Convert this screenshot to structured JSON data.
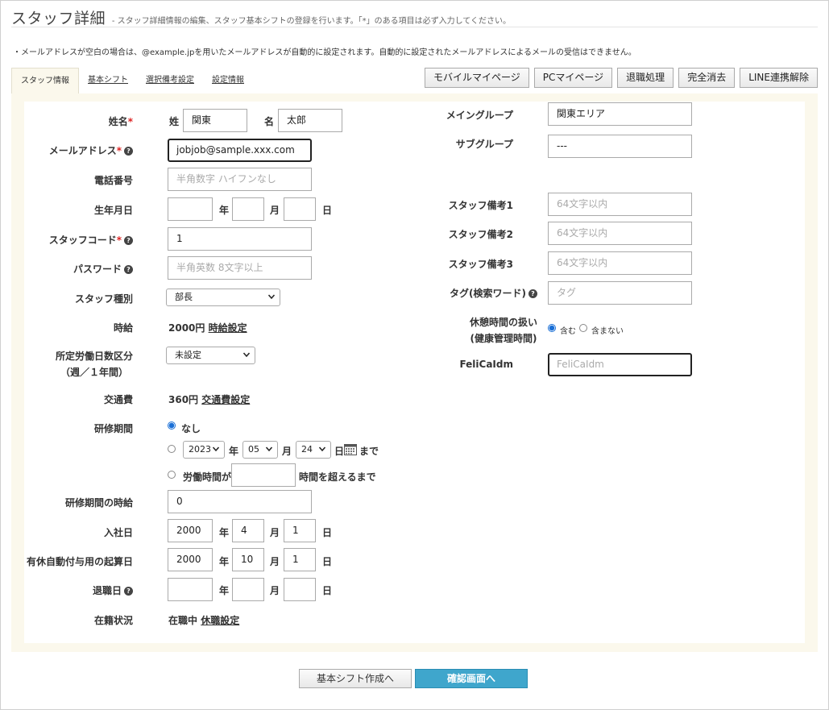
{
  "page": {
    "title": "スタッフ詳細",
    "subtitle": "- スタッフ詳細情報の編集、スタッフ基本シフトの登録を行います。「*」のある項目は必ず入力してください。",
    "notice": "・メールアドレスが空白の場合は、@example.jpを用いたメールアドレスが自動的に設定されます。自動的に設定されたメールアドレスによるメールの受信はできません。"
  },
  "tabs": [
    "スタッフ情報",
    "基本シフト",
    "選択備考設定",
    "設定情報"
  ],
  "actions": [
    "モバイルマイページ",
    "PCマイページ",
    "退職処理",
    "完全消去",
    "LINE連携解除"
  ],
  "form": {
    "name": {
      "label": "姓名",
      "req": "*",
      "sei_label": "姓",
      "sei": "関東",
      "mei_label": "名",
      "mei": "太郎"
    },
    "email": {
      "label": "メールアドレス",
      "req": "*",
      "value": "jobjob@sample.xxx.com"
    },
    "phone": {
      "label": "電話番号",
      "placeholder": "半角数字 ハイフンなし"
    },
    "birthday": {
      "label": "生年月日",
      "year_unit": "年",
      "month_unit": "月",
      "day_unit": "日"
    },
    "staff_code": {
      "label": "スタッフコード",
      "req": "*",
      "value": "1"
    },
    "password": {
      "label": "パスワード",
      "placeholder": "半角英数 8文字以上"
    },
    "staff_type": {
      "label": "スタッフ種別",
      "value": "部長"
    },
    "hourly": {
      "label": "時給",
      "value": "2000円",
      "link": "時給設定"
    },
    "workdays": {
      "label1": "所定労働日数区分",
      "label2": "（週／１年間）",
      "value": "未設定"
    },
    "transport": {
      "label": "交通費",
      "value": "360円",
      "link": "交通費設定"
    },
    "training": {
      "label": "研修期間",
      "opt_none": "なし",
      "year": "2023",
      "month": "05",
      "day": "24",
      "year_unit": "年",
      "month_unit": "月",
      "day_unit": "日",
      "until": "まで",
      "opt_hours_pre": "労働時間が",
      "opt_hours_post": "時間を超えるまで"
    },
    "training_wage": {
      "label": "研修期間の時給",
      "value": "0"
    },
    "join_date": {
      "label": "入社日",
      "year": "2000",
      "month": "4",
      "day": "1"
    },
    "paid_leave": {
      "label": "有休自動付与用の起算日",
      "year": "2000",
      "month": "10",
      "day": "1"
    },
    "retire_date": {
      "label": "退職日"
    },
    "status": {
      "label": "在籍状況",
      "value": "在職中",
      "link": "休職設定"
    },
    "main_group": {
      "label": "メイングループ",
      "value": "関東エリア"
    },
    "sub_group": {
      "label": "サブグループ",
      "value": "---"
    },
    "note1": {
      "label": "スタッフ備考1",
      "placeholder": "64文字以内"
    },
    "note2": {
      "label": "スタッフ備考2",
      "placeholder": "64文字以内"
    },
    "note3": {
      "label": "スタッフ備考3",
      "placeholder": "64文字以内"
    },
    "tag": {
      "label": "タグ(検索ワード)",
      "placeholder": "タグ"
    },
    "break": {
      "label1": "休憩時間の扱い",
      "label2": "(健康管理時間)",
      "opt_include": "含む",
      "opt_exclude": "含まない"
    },
    "felica": {
      "label": "FeliCaIdm",
      "placeholder": "FeliCaIdm"
    }
  },
  "bottom": {
    "shift_button": "基本シフト作成へ",
    "confirm_button": "確認画面へ"
  }
}
